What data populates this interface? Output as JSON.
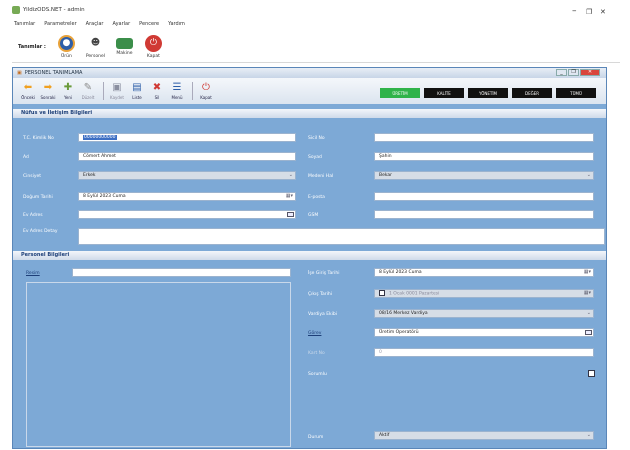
{
  "app": {
    "title": "YildizODS.NET - admin",
    "menu": [
      "Tanımlar",
      "Parametreler",
      "Araçlar",
      "Ayarlar",
      "Pencere",
      "Yardım"
    ],
    "quickbar_label": "Tanımlar :",
    "quick_buttons": [
      "Ürün",
      "Personel",
      "Makine",
      "Kapat"
    ],
    "colors": {
      "accent": "#7da9d6",
      "header_text": "#1d3f78",
      "green": "#2fb34a"
    }
  },
  "form": {
    "title": "PERSONEL TANIMLAMA",
    "toolbar": [
      "Önceki",
      "Sonraki",
      "Yeni",
      "Düzelt",
      "Kaydet",
      "Liste",
      "Sil",
      "Menü",
      "Kapat"
    ],
    "departments": [
      "ÜRETİM",
      "KALİTE",
      "YÖNETİM",
      "DEĞER",
      "TÜMÜ"
    ],
    "section_identity": "Nüfus ve İletişim Bilgileri",
    "section_personnel": "Personel Bilgileri",
    "fields": {
      "tc_label": "T.C. Kimlik No",
      "tc_value": "00000000000",
      "ad_label": "Ad",
      "ad_value": "Cömert Ahmet",
      "cinsiyet_label": "Cinsiyet",
      "cinsiyet_value": "Erkek",
      "dogum_label": "Doğum Tarihi",
      "dogum_value": "8   Eylül   2023   Cuma",
      "evadres_label": "Ev Adres",
      "evadres_value": "",
      "evadres_detay_label": "Ev Adres Detay",
      "evadres_detay_value": "",
      "sicil_label": "Sicil No",
      "sicil_value": "",
      "soyad_label": "Soyad",
      "soyad_value": "Şahin",
      "medeni_label": "Medeni Hal",
      "medeni_value": "Bekar",
      "eposta_label": "E-posta",
      "eposta_value": "",
      "gsm_label": "GSM",
      "gsm_value": ""
    },
    "personnel": {
      "resim_label": "Resim",
      "ise_giris_label": "İşe Giriş Tarihi",
      "ise_giris_value": "8   Eylül   2023   Cuma",
      "cikis_label": "Çıkış Tarihi",
      "cikis_value": "1   Ocak   0001 Pazartesi",
      "vardiya_label": "Vardiya Ekibi",
      "vardiya_value": "08/16 Merkez Vardiya",
      "gorev_label": "Görev",
      "gorev_value": "Üretim Operatörü",
      "kart_label": "Kart No",
      "kart_value": "0",
      "sorumlu_label": "Sorumlu",
      "durum_label": "Durum",
      "durum_value": "Aktif"
    }
  }
}
